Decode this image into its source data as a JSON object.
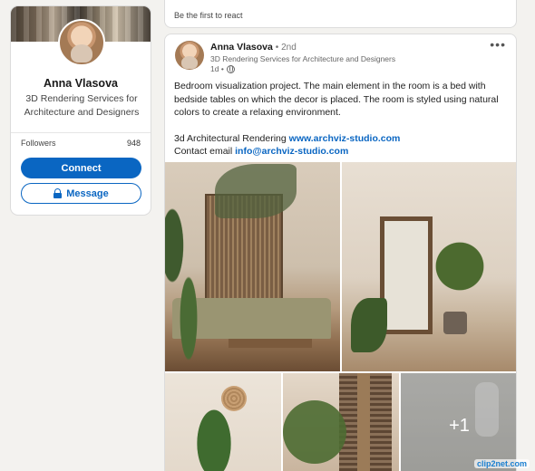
{
  "profile": {
    "name": "Anna Vlasova",
    "headline": "3D Rendering Services for Architecture and Designers",
    "stat_label": "Followers",
    "stat_value": "948",
    "connect_label": "Connect",
    "message_label": "Message"
  },
  "react_strip": {
    "text": "Be the first to react"
  },
  "post": {
    "author": "Anna Vlasova",
    "degree": "• 2nd",
    "author_headline": "3D Rendering Services for Architecture and Designers",
    "time": "1d •",
    "body": "Bedroom visualization project. The main element in the room is a bed with bedside tables on which the decor is placed. The room is styled using natural colors to create a relaxing environment.",
    "line1_text": "3d Architectural Rendering ",
    "line1_link": "www.archviz-studio.com",
    "line2_text": "Contact email ",
    "line2_link": "info@archviz-studio.com",
    "more_images": "+1"
  },
  "watermark": "clip2net.com",
  "colors": {
    "accent": "#0a66c2",
    "background": "#f3f2ef"
  }
}
